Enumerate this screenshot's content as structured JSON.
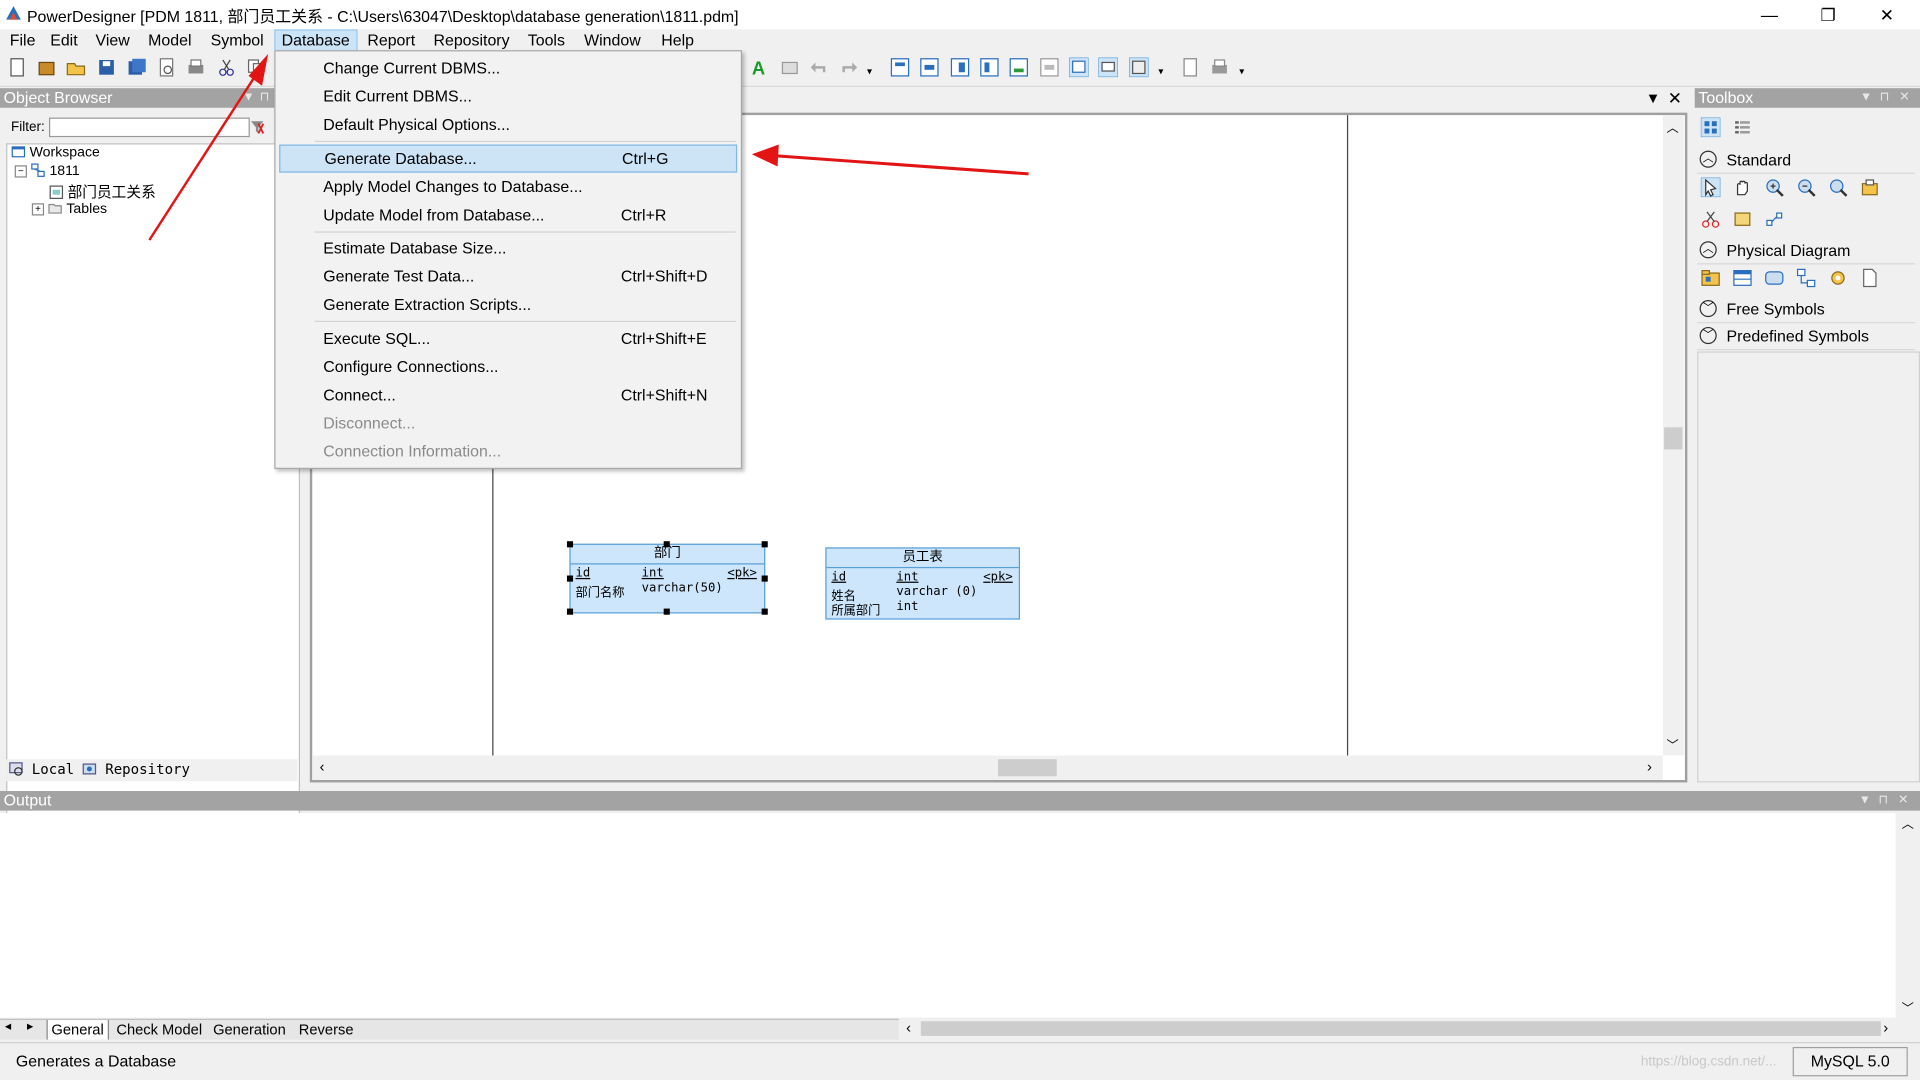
{
  "window": {
    "title": "PowerDesigner [PDM 1811, 部门员工关系 - C:\\Users\\63047\\Desktop\\database generation\\1811.pdm]",
    "minimize": "—",
    "restore": "❐",
    "close": "✕"
  },
  "menubar": {
    "items": [
      "File",
      "Edit",
      "View",
      "Model",
      "Symbol",
      "Database",
      "Report",
      "Repository",
      "Tools",
      "Window",
      "Help"
    ]
  },
  "object_browser": {
    "title": "Object Browser",
    "filter_label": "Filter:",
    "filter_value": "",
    "tree": {
      "workspace": "Workspace",
      "model": "1811",
      "diagram": "部门员工关系",
      "tables": "Tables"
    },
    "tabs": [
      "Local",
      "Repository"
    ]
  },
  "database_menu": {
    "items": [
      {
        "label": "Change Current DBMS...",
        "shortcut": "",
        "state": "normal"
      },
      {
        "label": "Edit Current DBMS...",
        "shortcut": "",
        "state": "normal"
      },
      {
        "label": "Default Physical Options...",
        "shortcut": "",
        "state": "normal"
      },
      {
        "label": "Generate Database...",
        "shortcut": "Ctrl+G",
        "state": "highlighted"
      },
      {
        "label": "Apply Model Changes to Database...",
        "shortcut": "",
        "state": "normal"
      },
      {
        "label": "Update Model from Database...",
        "shortcut": "Ctrl+R",
        "state": "normal"
      },
      {
        "label": "Estimate Database Size...",
        "shortcut": "",
        "state": "normal"
      },
      {
        "label": "Generate Test Data...",
        "shortcut": "Ctrl+Shift+D",
        "state": "normal"
      },
      {
        "label": "Generate Extraction Scripts...",
        "shortcut": "",
        "state": "normal"
      },
      {
        "label": "Execute SQL...",
        "shortcut": "Ctrl+Shift+E",
        "state": "normal"
      },
      {
        "label": "Configure Connections...",
        "shortcut": "",
        "state": "normal"
      },
      {
        "label": "Connect...",
        "shortcut": "Ctrl+Shift+N",
        "state": "normal"
      },
      {
        "label": "Disconnect...",
        "shortcut": "",
        "state": "disabled"
      },
      {
        "label": "Connection Information...",
        "shortcut": "",
        "state": "disabled"
      }
    ]
  },
  "diagram": {
    "entities": [
      {
        "name": "部门",
        "rows": [
          {
            "col": "id",
            "type": "int",
            "key": "<pk>"
          },
          {
            "col": "部门名称",
            "type": "varchar(50)",
            "key": ""
          }
        ]
      },
      {
        "name": "员工表",
        "rows": [
          {
            "col": "id",
            "type": "int",
            "key": "<pk>"
          },
          {
            "col": "姓名",
            "type": "varchar (0)",
            "key": ""
          },
          {
            "col": "所属部门",
            "type": "int",
            "key": ""
          }
        ]
      }
    ]
  },
  "toolbox": {
    "title": "Toolbox",
    "sections": [
      "Standard",
      "Physical Diagram",
      "Free Symbols",
      "Predefined Symbols"
    ]
  },
  "output": {
    "title": "Output",
    "tabs": [
      "General",
      "Check Model",
      "Generation",
      "Reverse"
    ]
  },
  "status": {
    "message": "Generates a Database",
    "dbms": "MySQL 5.0",
    "watermark": "https://blog.csdn.net/..."
  },
  "colors": {
    "menu_highlight": "#cde4f7",
    "entity_fill": "#cde6fb",
    "arrow": "#e31414",
    "panel_header": "#a3a3a3"
  }
}
